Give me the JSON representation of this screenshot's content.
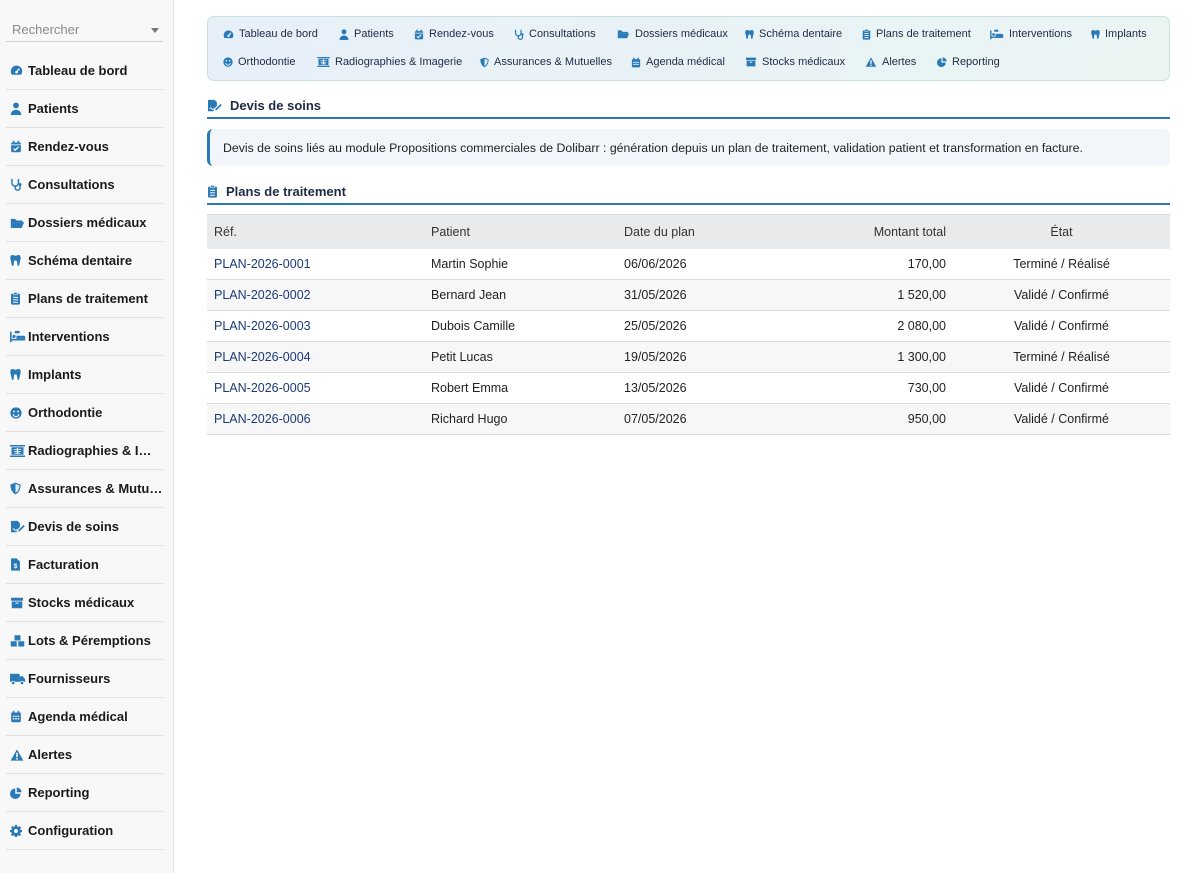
{
  "sidebar": {
    "search_placeholder": "Rechercher",
    "items": [
      {
        "label": "Tableau de bord",
        "icon": "gauge-icon"
      },
      {
        "label": "Patients",
        "icon": "user-icon"
      },
      {
        "label": "Rendez-vous",
        "icon": "calendar-check-icon"
      },
      {
        "label": "Consultations",
        "icon": "stethoscope-icon"
      },
      {
        "label": "Dossiers médicaux",
        "icon": "folder-open-icon"
      },
      {
        "label": "Schéma dentaire",
        "icon": "tooth-icon"
      },
      {
        "label": "Plans de traitement",
        "icon": "clipboard-list-icon"
      },
      {
        "label": "Interventions",
        "icon": "procedures-icon"
      },
      {
        "label": "Implants",
        "icon": "tooth-icon"
      },
      {
        "label": "Orthodontie",
        "icon": "smile-icon"
      },
      {
        "label": "Radiographies & Imagerie",
        "icon": "x-ray-icon"
      },
      {
        "label": "Assurances & Mutuelles",
        "icon": "shield-icon"
      },
      {
        "label": "Devis de soins",
        "icon": "file-signature-icon"
      },
      {
        "label": "Facturation",
        "icon": "file-invoice-icon"
      },
      {
        "label": "Stocks médicaux",
        "icon": "box-icon"
      },
      {
        "label": "Lots & Péremptions",
        "icon": "boxes-icon"
      },
      {
        "label": "Fournisseurs",
        "icon": "truck-icon"
      },
      {
        "label": "Agenda médical",
        "icon": "calendar-icon"
      },
      {
        "label": "Alertes",
        "icon": "warning-icon"
      },
      {
        "label": "Reporting",
        "icon": "pie-chart-icon"
      },
      {
        "label": "Configuration",
        "icon": "gear-icon"
      }
    ]
  },
  "topnav": {
    "row1": [
      {
        "label": "Tableau de bord",
        "icon": "gauge-icon"
      },
      {
        "label": "Patients",
        "icon": "user-icon"
      },
      {
        "label": "Rendez-vous",
        "icon": "calendar-check-icon"
      },
      {
        "label": "Consultations",
        "icon": "stethoscope-icon"
      },
      {
        "label": "Dossiers médicaux",
        "icon": "folder-open-icon"
      },
      {
        "label": "Schéma dentaire",
        "icon": "tooth-icon"
      },
      {
        "label": "Plans de traitement",
        "icon": "clipboard-list-icon"
      },
      {
        "label": "Interventions",
        "icon": "procedures-icon"
      },
      {
        "label": "Implants",
        "icon": "tooth-icon"
      }
    ],
    "row2": [
      {
        "label": "Orthodontie",
        "icon": "smile-icon"
      },
      {
        "label": "Radiographies & Imagerie",
        "icon": "x-ray-icon"
      },
      {
        "label": "Assurances & Mutuelles",
        "icon": "shield-icon"
      },
      {
        "label": "Agenda médical",
        "icon": "calendar-icon"
      },
      {
        "label": "Stocks médicaux",
        "icon": "box-icon"
      },
      {
        "label": "Alertes",
        "icon": "warning-icon"
      },
      {
        "label": "Reporting",
        "icon": "pie-chart-icon"
      }
    ]
  },
  "devis": {
    "title": "Devis de soins",
    "info": "Devis de soins liés au module Propositions commerciales de Dolibarr : génération depuis un plan de traitement, validation patient et transformation en facture."
  },
  "plans": {
    "title": "Plans de traitement",
    "columns": {
      "ref": "Réf.",
      "patient": "Patient",
      "date": "Date du plan",
      "montant": "Montant total",
      "etat": "État"
    },
    "rows": [
      {
        "ref": "PLAN-2026-0001",
        "patient": "Martin Sophie",
        "date": "06/06/2026",
        "montant": "170,00",
        "etat": "Terminé / Réalisé"
      },
      {
        "ref": "PLAN-2026-0002",
        "patient": "Bernard Jean",
        "date": "31/05/2026",
        "montant": "1 520,00",
        "etat": "Validé / Confirmé"
      },
      {
        "ref": "PLAN-2026-0003",
        "patient": "Dubois Camille",
        "date": "25/05/2026",
        "montant": "2 080,00",
        "etat": "Validé / Confirmé"
      },
      {
        "ref": "PLAN-2026-0004",
        "patient": "Petit Lucas",
        "date": "19/05/2026",
        "montant": "1 300,00",
        "etat": "Terminé / Réalisé"
      },
      {
        "ref": "PLAN-2026-0005",
        "patient": "Robert Emma",
        "date": "13/05/2026",
        "montant": "730,00",
        "etat": "Validé / Confirmé"
      },
      {
        "ref": "PLAN-2026-0006",
        "patient": "Richard Hugo",
        "date": "07/05/2026",
        "montant": "950,00",
        "etat": "Validé / Confirmé"
      }
    ]
  },
  "colors": {
    "icon_blue": "#2a7ab8",
    "link_blue": "#1b3a7a",
    "accent_line": "#2a7ab8"
  }
}
